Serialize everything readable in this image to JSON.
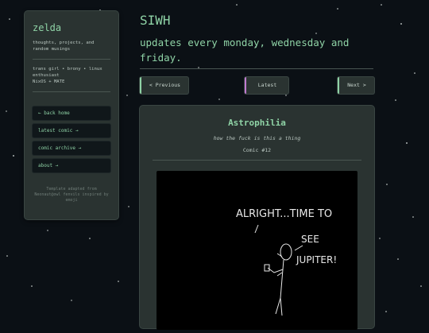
{
  "sidebar": {
    "site_title": "zelda",
    "tagline": "thoughts, projects, and random musings",
    "bio_line1": "trans girl • brony • linux enthusiast",
    "bio_line2": "NixOS + MATE",
    "nav": [
      {
        "label": "← back home"
      },
      {
        "label": "latest comic →"
      },
      {
        "label": "comic archive →"
      },
      {
        "label": "about →"
      }
    ],
    "credit": "Template adapted from Neonaut@owl fenvils inspired by emoji"
  },
  "header": {
    "title": "SIWH",
    "subtitle": "updates every monday, wednesday and friday."
  },
  "pagination": {
    "prev_label": "< Previous",
    "latest_label": "Latest",
    "next_label": "Next >"
  },
  "comic": {
    "title": "Astrophilia",
    "subtitle": "how the fuck is this a thing",
    "number": "Comic #12",
    "caption_line1": "ALRIGHT...TIME TO",
    "caption_line2": "SEE",
    "caption_line3": "JUPITER!"
  },
  "colors": {
    "accent": "#8fd3a6",
    "background": "#0b1015",
    "panel": "#2a3331",
    "latest_accent": "#c07ad0"
  }
}
